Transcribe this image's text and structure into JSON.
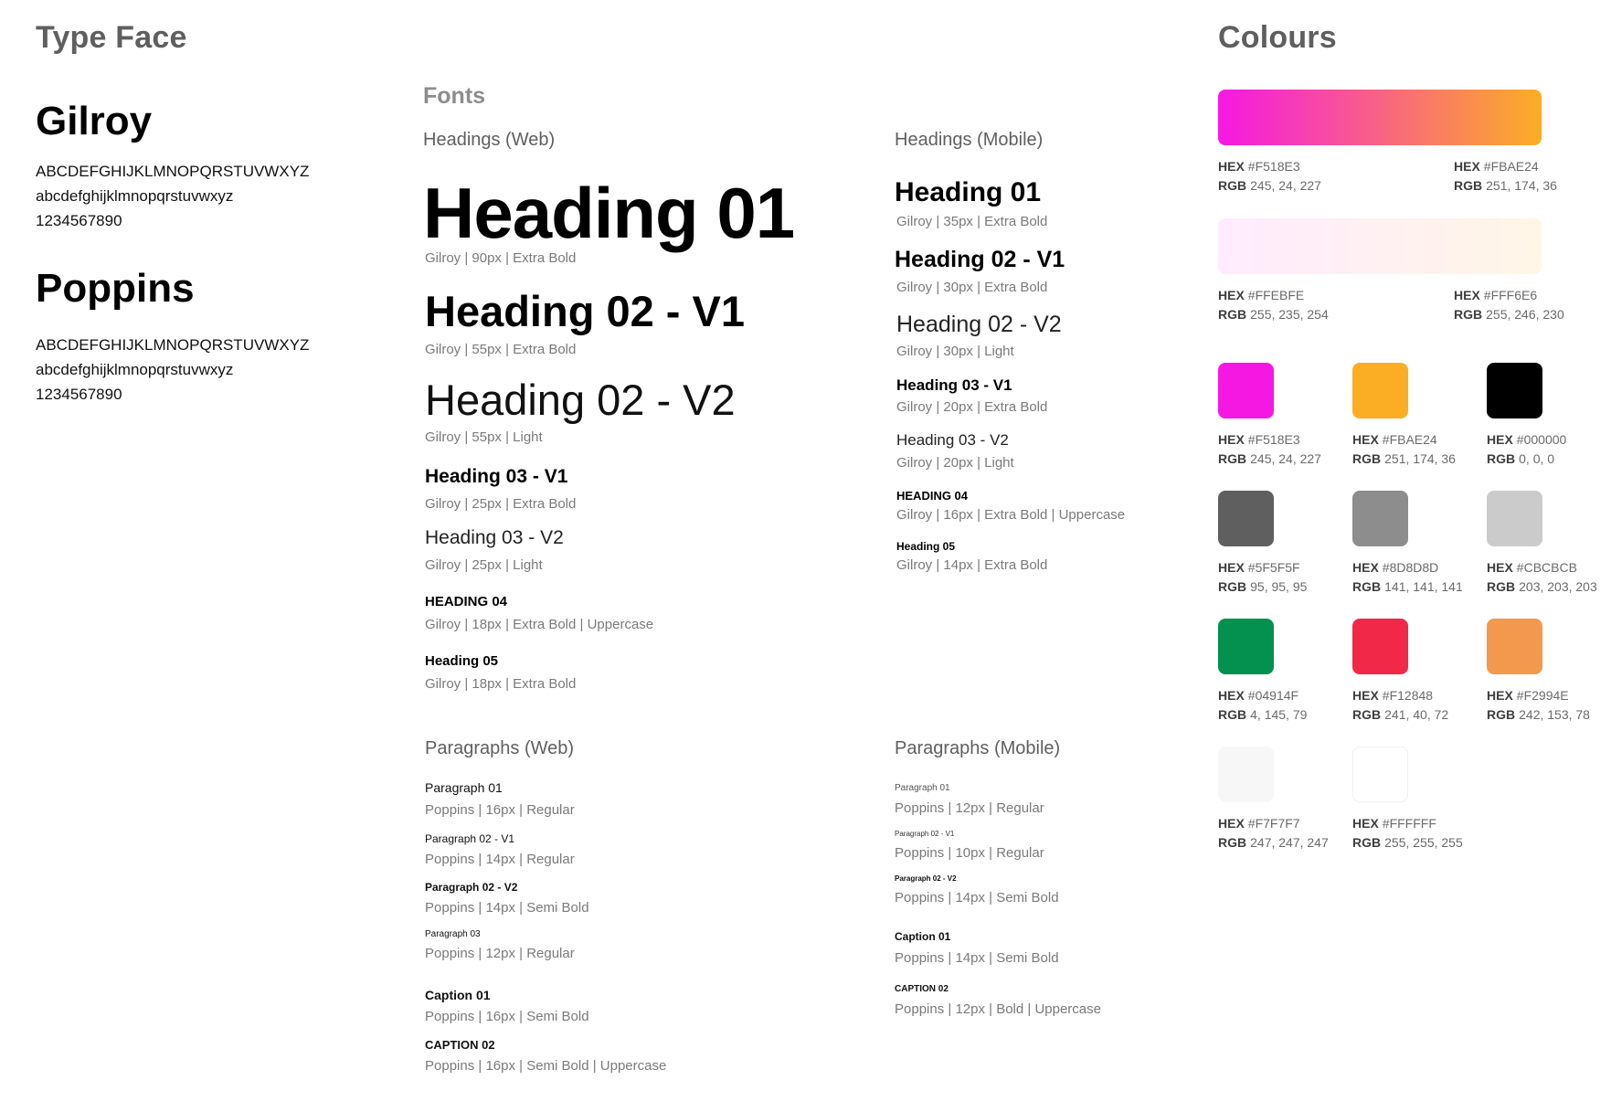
{
  "typeface": {
    "title": "Type Face",
    "fonts": [
      {
        "name": "Gilroy",
        "upper": "ABCDEFGHIJKLMNOPQRSTUVWXYZ",
        "lower": "abcdefghijklmnopqrstuvwxyz",
        "digits": "1234567890"
      },
      {
        "name": "Poppins",
        "upper": "ABCDEFGHIJKLMNOPQRSTUVWXYZ",
        "lower": "abcdefghijklmnopqrstuvwxyz",
        "digits": "1234567890"
      }
    ]
  },
  "fonts": {
    "title": "Fonts",
    "headings_web": {
      "label": "Headings (Web)",
      "items": [
        {
          "text": "Heading 01",
          "spec": "Gilroy | 90px | Extra Bold"
        },
        {
          "text": "Heading 02 - V1",
          "spec": "Gilroy | 55px | Extra Bold"
        },
        {
          "text": "Heading 02 - V2",
          "spec": "Gilroy | 55px | Light"
        },
        {
          "text": "Heading 03 - V1",
          "spec": "Gilroy | 25px | Extra Bold"
        },
        {
          "text": "Heading 03 - V2",
          "spec": "Gilroy | 25px | Light"
        },
        {
          "text": "HEADING 04",
          "spec": "Gilroy | 18px | Extra Bold | Uppercase"
        },
        {
          "text": "Heading 05",
          "spec": "Gilroy | 18px | Extra Bold"
        }
      ]
    },
    "headings_mobile": {
      "label": "Headings (Mobile)",
      "items": [
        {
          "text": "Heading 01",
          "spec": "Gilroy | 35px | Extra Bold"
        },
        {
          "text": "Heading 02 - V1",
          "spec": "Gilroy | 30px | Extra Bold"
        },
        {
          "text": "Heading 02 - V2",
          "spec": "Gilroy | 30px | Light"
        },
        {
          "text": "Heading 03 - V1",
          "spec": "Gilroy | 20px | Extra Bold"
        },
        {
          "text": "Heading 03 - V2",
          "spec": "Gilroy | 20px | Light"
        },
        {
          "text": "HEADING 04",
          "spec": "Gilroy | 16px | Extra Bold | Uppercase"
        },
        {
          "text": "Heading 05",
          "spec": "Gilroy | 14px | Extra Bold"
        }
      ]
    },
    "paragraphs_web": {
      "label": "Paragraphs (Web)",
      "items": [
        {
          "text": "Paragraph 01",
          "spec": "Poppins | 16px | Regular"
        },
        {
          "text": "Paragraph 02 - V1",
          "spec": "Poppins | 14px | Regular"
        },
        {
          "text": "Paragraph 02 - V2",
          "spec": "Poppins | 14px | Semi Bold"
        },
        {
          "text": "Paragraph 03",
          "spec": "Poppins | 12px | Regular"
        },
        {
          "text": "Caption 01",
          "spec": "Poppins | 16px | Semi Bold"
        },
        {
          "text": "CAPTION 02",
          "spec": "Poppins | 16px | Semi Bold | Uppercase"
        }
      ]
    },
    "paragraphs_mobile": {
      "label": "Paragraphs (Mobile)",
      "items": [
        {
          "text": "Paragraph 01",
          "spec": "Poppins | 12px | Regular"
        },
        {
          "text": "Paragraph 02 - V1",
          "spec": "Poppins | 10px | Regular"
        },
        {
          "text": "Paragraph 02 - V2",
          "spec": "Poppins | 14px | Semi Bold"
        },
        {
          "text": "Caption 01",
          "spec": "Poppins | 14px | Semi Bold"
        },
        {
          "text": "CAPTION 02",
          "spec": "Poppins | 12px | Bold | Uppercase"
        }
      ]
    }
  },
  "colours": {
    "title": "Colours",
    "hex_label": "HEX",
    "rgb_label": "RGB",
    "gradients": [
      {
        "start": {
          "hex": "#F518E3",
          "rgb": "245, 24, 227"
        },
        "end": {
          "hex": "#FBAE24",
          "rgb": "251, 174, 36"
        }
      },
      {
        "start": {
          "hex": "#FFEBFE",
          "rgb": "255, 235, 254"
        },
        "end": {
          "hex": "#FFF6E6",
          "rgb": "255, 246, 230"
        }
      }
    ],
    "swatches": [
      {
        "hex": "#F518E3",
        "rgb": "245, 24, 227"
      },
      {
        "hex": "#FBAE24",
        "rgb": "251, 174, 36"
      },
      {
        "hex": "#000000",
        "rgb": "0, 0, 0"
      },
      {
        "hex": "#5F5F5F",
        "rgb": "95, 95, 95"
      },
      {
        "hex": "#8D8D8D",
        "rgb": "141, 141, 141"
      },
      {
        "hex": "#CBCBCB",
        "rgb": "203, 203, 203"
      },
      {
        "hex": "#04914F",
        "rgb": "4, 145, 79"
      },
      {
        "hex": "#F12848",
        "rgb": "241, 40, 72"
      },
      {
        "hex": "#F2994E",
        "rgb": "242, 153, 78"
      },
      {
        "hex": "#F7F7F7",
        "rgb": "247, 247, 247"
      },
      {
        "hex": "#FFFFFF",
        "rgb": "255, 255, 255"
      }
    ]
  }
}
